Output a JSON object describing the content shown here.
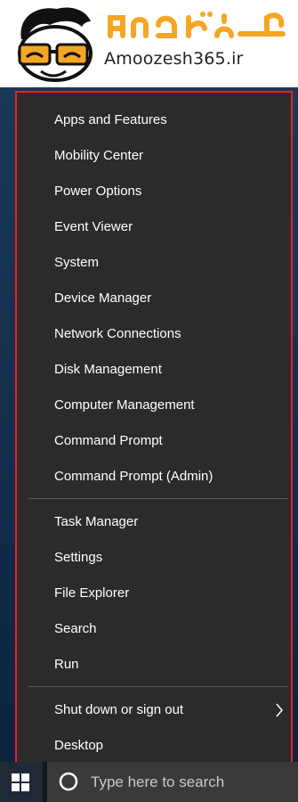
{
  "brand": {
    "site": "Amoozesh365.ir",
    "persian_title": "آموزش ۳۶۵"
  },
  "menu": {
    "group1": [
      "Apps and Features",
      "Mobility Center",
      "Power Options",
      "Event Viewer",
      "System",
      "Device Manager",
      "Network Connections",
      "Disk Management",
      "Computer Management",
      "Command Prompt",
      "Command Prompt (Admin)"
    ],
    "group2": [
      "Task Manager",
      "Settings",
      "File Explorer",
      "Search",
      "Run"
    ],
    "group3": [
      "Shut down or sign out",
      "Desktop"
    ],
    "submenu_icon": "chevron-right-icon"
  },
  "taskbar": {
    "search_placeholder": "Type here to search",
    "start_icon": "windows-logo-icon",
    "cortana_icon": "cortana-ring-icon"
  },
  "colors": {
    "menu_bg": "#2b2b2b",
    "highlight_border": "#e8202a",
    "brand_orange": "#f5a623",
    "text": "#ffffff"
  }
}
